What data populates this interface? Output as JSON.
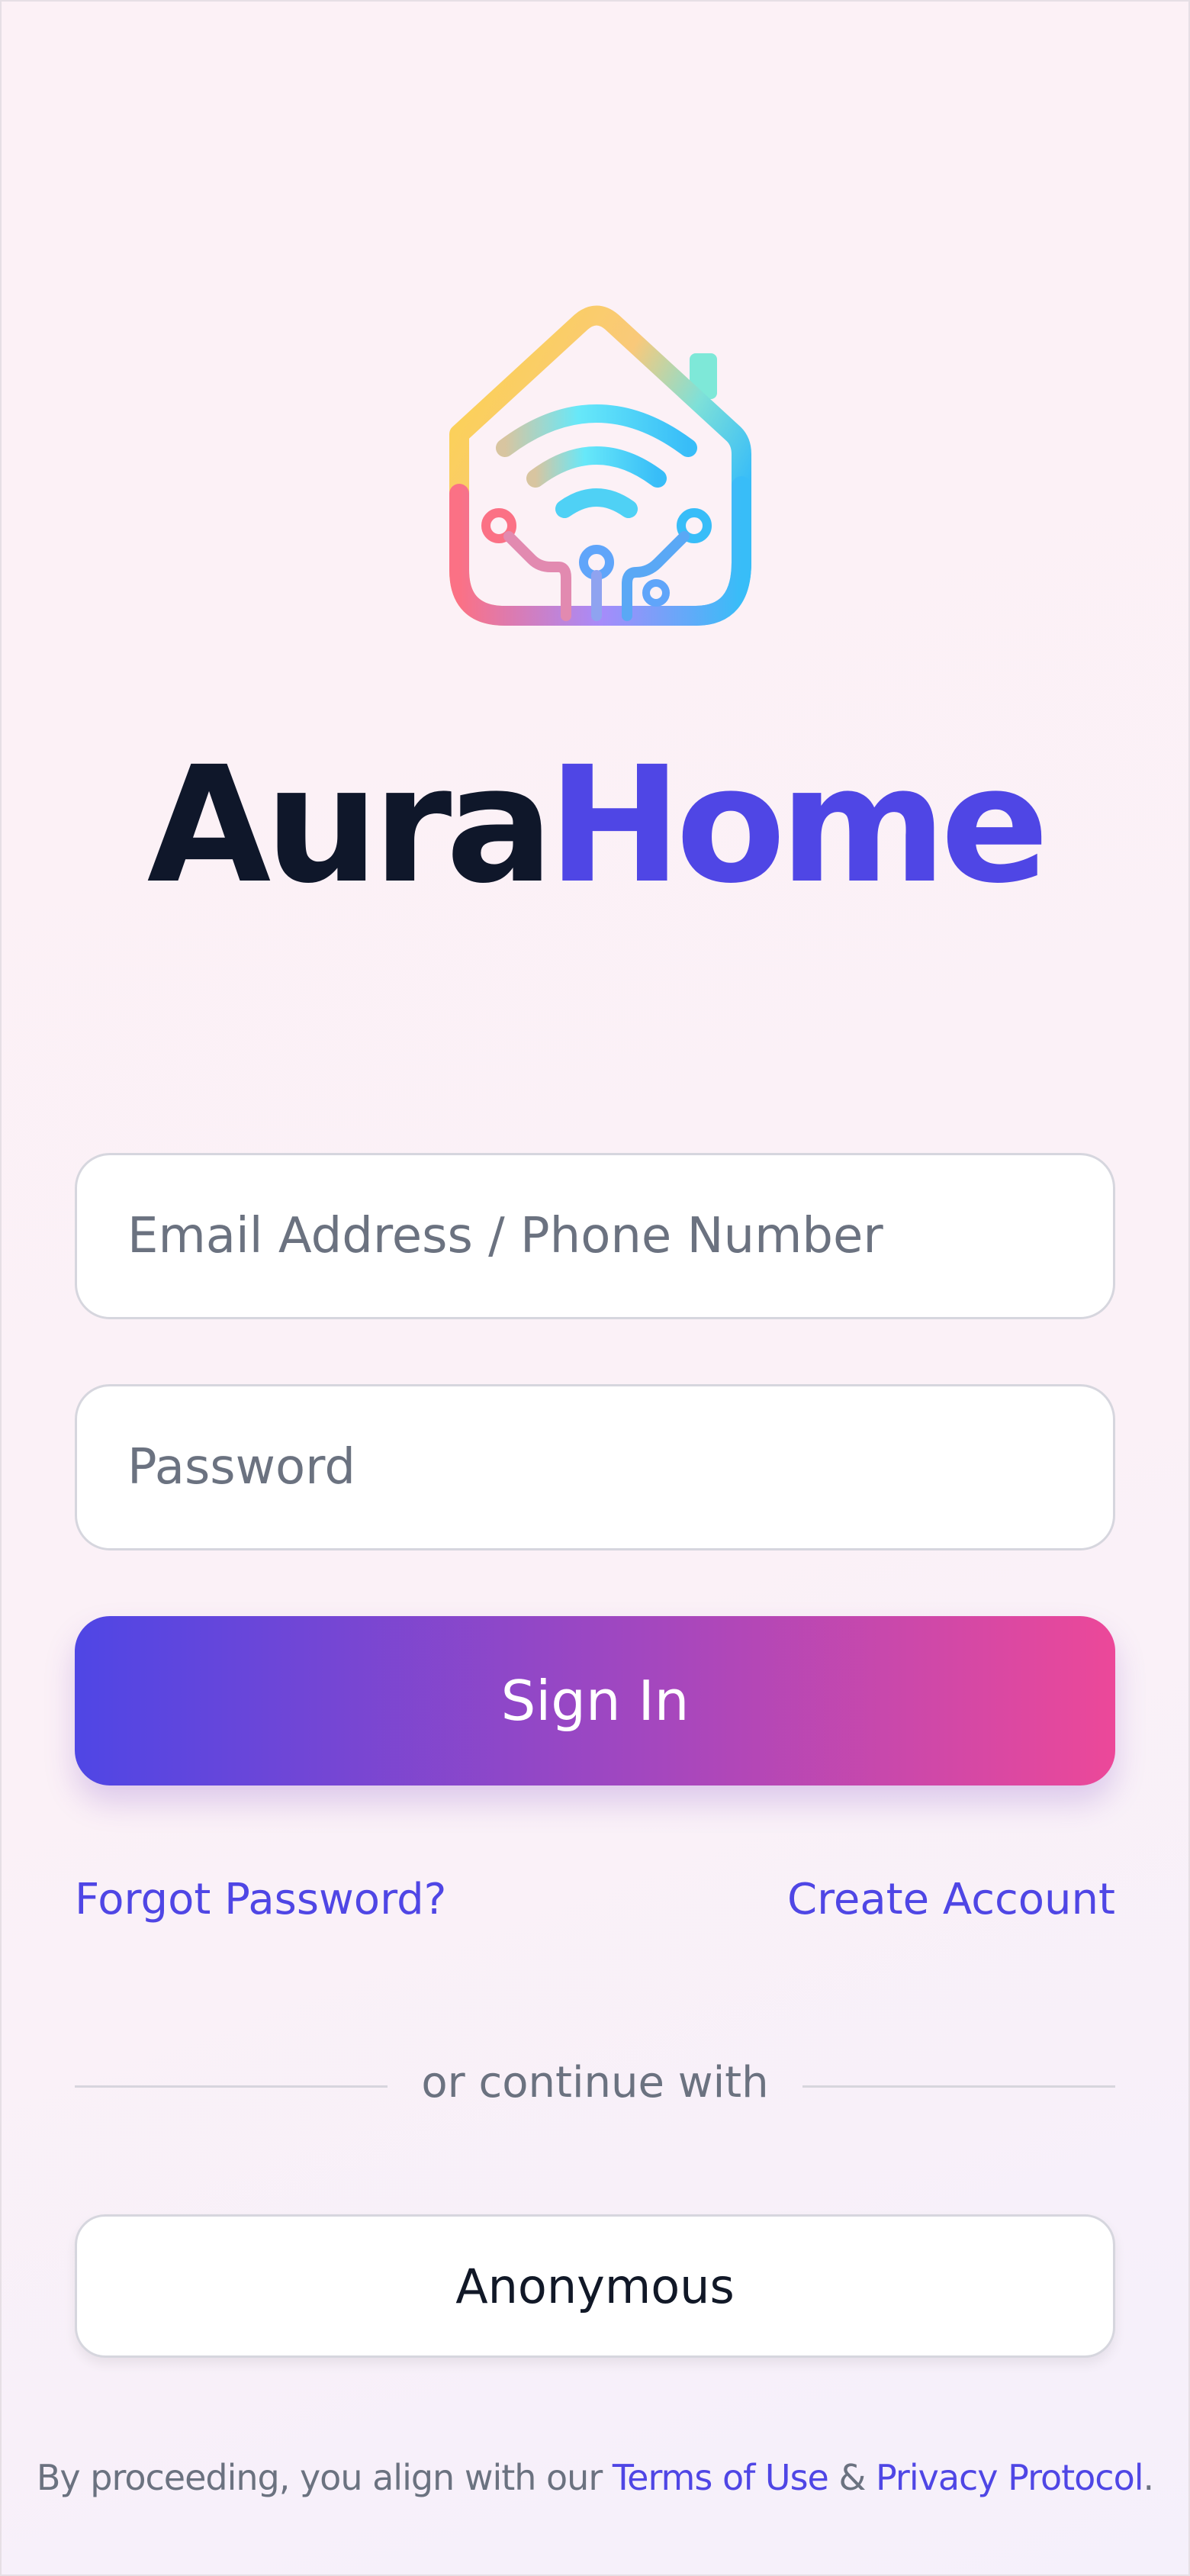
{
  "app": {
    "brand_part1": "Aura",
    "brand_part2": "Home",
    "logo_icon": "smart-home-wifi-icon"
  },
  "form": {
    "email_placeholder": "Email Address / Phone Number",
    "password_placeholder": "Password",
    "signin_label": "Sign In"
  },
  "links": {
    "forgot_password": "Forgot Password?",
    "create_account": "Create Account"
  },
  "alt_login": {
    "divider_text": "or continue with",
    "anonymous_label": "Anonymous"
  },
  "legal": {
    "prefix": "By proceeding, you align with our ",
    "terms": "Terms of Use",
    "ampersand": " & ",
    "privacy": "Privacy Protocol",
    "suffix": "."
  },
  "colors": {
    "accent": "#4f46e5",
    "gradient_end": "#ec4899",
    "text_dark": "#0f172a",
    "muted": "#6b7280"
  }
}
